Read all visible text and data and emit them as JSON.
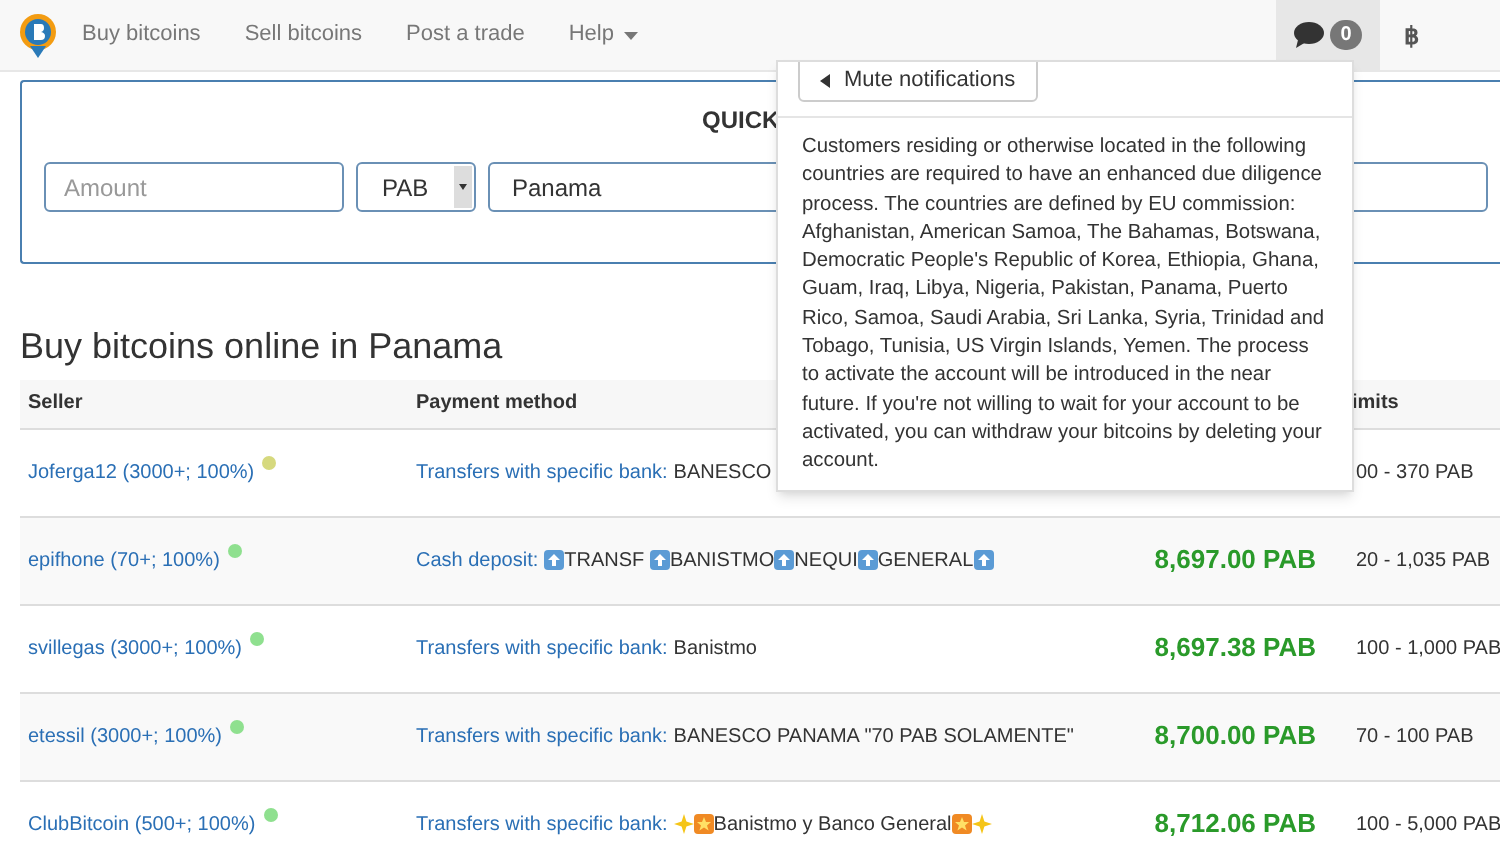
{
  "navbar": {
    "items": [
      {
        "label": "Buy bitcoins",
        "kind": "link"
      },
      {
        "label": "Sell bitcoins",
        "kind": "link"
      },
      {
        "label": "Post a trade",
        "kind": "link"
      },
      {
        "label": "Help",
        "kind": "dropdown"
      }
    ],
    "notifications": {
      "count": "0",
      "expanded": true
    },
    "currency_symbol": "฿"
  },
  "quick_search": {
    "title": "QUICK",
    "amount": {
      "placeholder": "Amount"
    },
    "currency": "PAB",
    "country": "Panama"
  },
  "notifications_menu": {
    "mute_button": "Mute notifications",
    "message": "Customers residing or otherwise located in the following countries are required to have an enhanced due diligence process. The countries are defined by EU commission: Afghanistan, American Samoa, The Bahamas, Botswana, Democratic People's Republic of Korea, Ethiopia, Ghana, Guam, Iraq, Libya, Nigeria, Pakistan, Panama, Puerto Rico, Samoa, Saudi Arabia, Sri Lanka, Syria, Trinidad and Tobago, Tunisia, US Virgin Islands, Yemen. The process to activate the account will be introduced in the near future. If you're not willing to wait for your account to be activated, you can withdraw your bitcoins by deleting your account."
  },
  "heading": "Buy bitcoins online in Panama",
  "table": {
    "columns": [
      "Seller",
      "Payment method",
      "imits"
    ],
    "rows": [
      {
        "seller": "Joferga12 (3000+; 100%)",
        "color": "#d6d97e",
        "method": "Transfers with specific bank:",
        "details": [
          {
            "kind": "text",
            "text": "BANESCO"
          }
        ],
        "price": "",
        "limits": "00 - 370 PAB"
      },
      {
        "seller": "epifhone (70+; 100%)",
        "color": "#8fe08f",
        "method": "Cash deposit:",
        "details": [
          {
            "kind": "up"
          },
          {
            "kind": "text",
            "text": "TRANSF "
          },
          {
            "kind": "up"
          },
          {
            "kind": "text",
            "text": "BANISTMO"
          },
          {
            "kind": "up"
          },
          {
            "kind": "text",
            "text": "NEQUI"
          },
          {
            "kind": "up"
          },
          {
            "kind": "text",
            "text": "GENERAL"
          },
          {
            "kind": "up"
          }
        ],
        "price": "8,697.00 PAB",
        "limits": "20 - 1,035 PAB"
      },
      {
        "seller": "svillegas (3000+; 100%)",
        "color": "#8fe08f",
        "method": "Transfers with specific bank:",
        "details": [
          {
            "kind": "text",
            "text": "Banistmo"
          }
        ],
        "price": "8,697.38 PAB",
        "limits": "100 - 1,000 PAB"
      },
      {
        "seller": "etessil (3000+; 100%)",
        "color": "#8fe08f",
        "method": "Transfers with specific bank:",
        "details": [
          {
            "kind": "text",
            "text": "BANESCO PANAMA \"70 PAB SOLAMENTE\""
          }
        ],
        "price": "8,700.00 PAB",
        "limits": "70 - 100 PAB"
      },
      {
        "seller": "ClubBitcoin (500+; 100%)",
        "color": "#8fe08f",
        "method": "Transfers with specific bank:",
        "details": [
          {
            "kind": "sparkle"
          },
          {
            "kind": "star"
          },
          {
            "kind": "text",
            "text": "Banistmo y Banco General"
          },
          {
            "kind": "star"
          },
          {
            "kind": "sparkle"
          }
        ],
        "price": "8,712.06 PAB",
        "limits": "100 - 5,000 PAB"
      }
    ]
  }
}
